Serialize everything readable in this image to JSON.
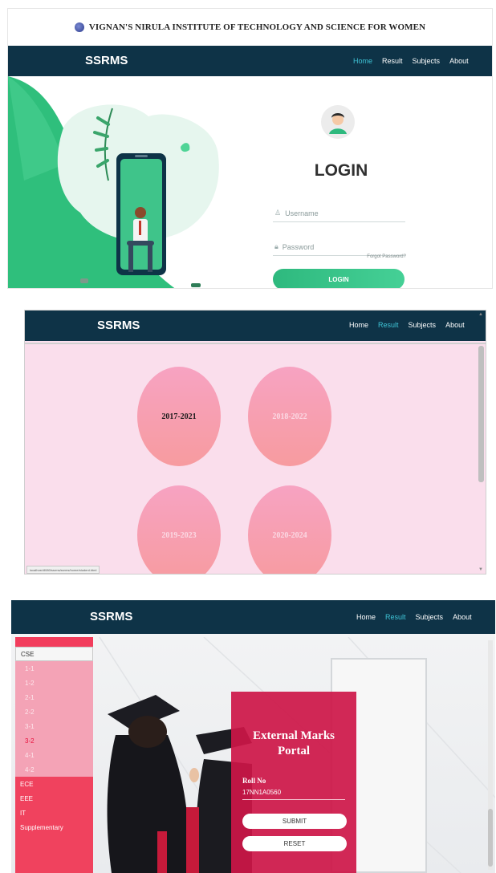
{
  "panel1": {
    "institute": "VIGNAN'S NIRULA INSTITUTE OF TECHNOLOGY AND SCIENCE FOR WOMEN",
    "brand": "SSRMS",
    "nav": [
      "Home",
      "Result",
      "Subjects",
      "About"
    ],
    "active_nav": "Home",
    "login_title": "LOGIN",
    "username_placeholder": "Username",
    "password_placeholder": "Password",
    "forgot": "Forgot Password?",
    "login_button": "LOGIN",
    "accent_color": "#2eb97e",
    "navbar_color": "#0e3347"
  },
  "panel2": {
    "brand": "SSRMS",
    "nav": [
      "Home",
      "Result",
      "Subjects",
      "About"
    ],
    "active_nav": "Result",
    "years": [
      "2017-2021",
      "2018-2022",
      "2019-2023",
      "2020-2024"
    ],
    "status_url": "localhost:8080/ssrms/ssrms/home/student.html"
  },
  "panel3": {
    "brand": "SSRMS",
    "nav": [
      "Home",
      "Result",
      "Subjects",
      "About"
    ],
    "active_nav": "Result",
    "sidebar": {
      "branch_selected": "CSE",
      "semesters": [
        "1-1",
        "1-2",
        "2-1",
        "2-2",
        "3-1",
        "3-2",
        "4-1",
        "4-2"
      ],
      "highlighted_semester": "3-2",
      "other_branches": [
        "ECE",
        "EEE",
        "IT",
        "Supplementary"
      ]
    },
    "portal_title_line1": "External Marks",
    "portal_title_line2": "Portal",
    "roll_label": "Roll No",
    "roll_value": "17NN1A0560",
    "submit": "SUBMIT",
    "reset": "RESET"
  }
}
